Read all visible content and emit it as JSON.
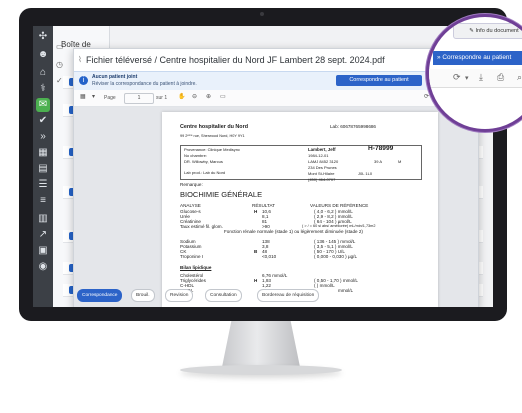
{
  "app": {
    "list_title": "Boîte de",
    "modal_title": "Fichier téléversé / Centre hospitalier du Nord JF Lambert 28 sept. 2024.pdf",
    "info_button": "Info du document"
  },
  "notice": {
    "title": "Aucun patient joint",
    "subtitle": "Réviser la correspondance du patient à joindre.",
    "match_button": "Correspondre au patient"
  },
  "toolbar": {
    "page_label": "Page",
    "page_current": "1",
    "page_total": "sur 1"
  },
  "document": {
    "hospital": "Centre hospitalier du Nord",
    "lab_id": "Lab: 60678765998686",
    "address": "99 2ᵉᵐᵉ rue, Sherwood Nord, H0Y 9Y1",
    "provenance": "Provenance: Clinique Medisync",
    "requester": "No chambre:",
    "doctor": "DR. Willowby, Marcus",
    "lab_prod": "Lab prod.: Lab du Nord",
    "patient_name": "Lambert, Jeff",
    "patient_code": "H-78999",
    "dob": "1984-12-01",
    "health_no": "LAMJ 8452 3120",
    "age": "39 A",
    "sex": "M",
    "street": "234 Des Prunes",
    "city": "Mont St-Hilaire",
    "postal": "J0L 1L0",
    "phone": "(450) 464-0707",
    "remark": "Remarque:",
    "section": "BIOCHIMIE GÉNÉRALE",
    "col_analysis": "ANALYSE",
    "col_result": "RÉSULTAT",
    "col_ref": "VALEURS DE RÉFÉRENCE",
    "rows": [
      {
        "name": "Glucose-s",
        "flag": "H",
        "value": "10,6",
        "ref": "( 4,0 - 6,2 ) mmol/L"
      },
      {
        "name": "Urée",
        "flag": "",
        "value": "8,1",
        "ref": "( 2,9 - 8,2 ) mmol/L"
      },
      {
        "name": "Créatinine",
        "flag": "",
        "value": "81",
        "ref": "( 64 - 104 ) µmol/L"
      },
      {
        "name": "Taux estimé fil. glom.",
        "flag": "",
        "value": ">90",
        "ref": "( > / = 60 si abs/ améliorée) mL/min/1,73m2"
      }
    ],
    "gfr_note": "Fonction rénale normale (stade 1) ou légèrement diminuée (stade 2)",
    "rows2": [
      {
        "name": "Sodium",
        "flag": "",
        "value": "138",
        "ref": "( 136 - 145 ) mmol/L"
      },
      {
        "name": "Potassium",
        "flag": "",
        "value": "3,8",
        "ref": "( 3,5 - 5,1 ) mmol/L"
      },
      {
        "name": "CK",
        "flag": "B",
        "value": "48",
        "ref": "( 50 - 170 ) U/L"
      },
      {
        "name": "Troponine I",
        "flag": "",
        "value": "<0,010",
        "ref": "( 0,000 - 0,030 ) µg/L"
      }
    ],
    "lipid_title": "Bilan lipidique",
    "rows3": [
      {
        "name": "Cholestérol",
        "flag": "",
        "value": "6,76 mmol/L",
        "ref": ""
      },
      {
        "name": "Triglycérides",
        "flag": "H",
        "value": "1,93",
        "ref": "( 0,50 - 1,70 ) mmol/L"
      },
      {
        "name": "C-HDL",
        "flag": "",
        "value": "1,22",
        "ref": "( ) mmol/L"
      },
      {
        "name": "C-LDL",
        "flag": "",
        "value": "4,77",
        "ref": "mmol/L"
      }
    ]
  },
  "actions": {
    "correspondence": "Correspondance",
    "draft": "Brouil.",
    "review": "Revision",
    "consultation": "Consultation",
    "requisition": "Bordereau de réquisition"
  },
  "colors": {
    "accent": "#2c63c8",
    "sidebar": "#3c4046",
    "magnifier_ring": "#6f3f96"
  }
}
